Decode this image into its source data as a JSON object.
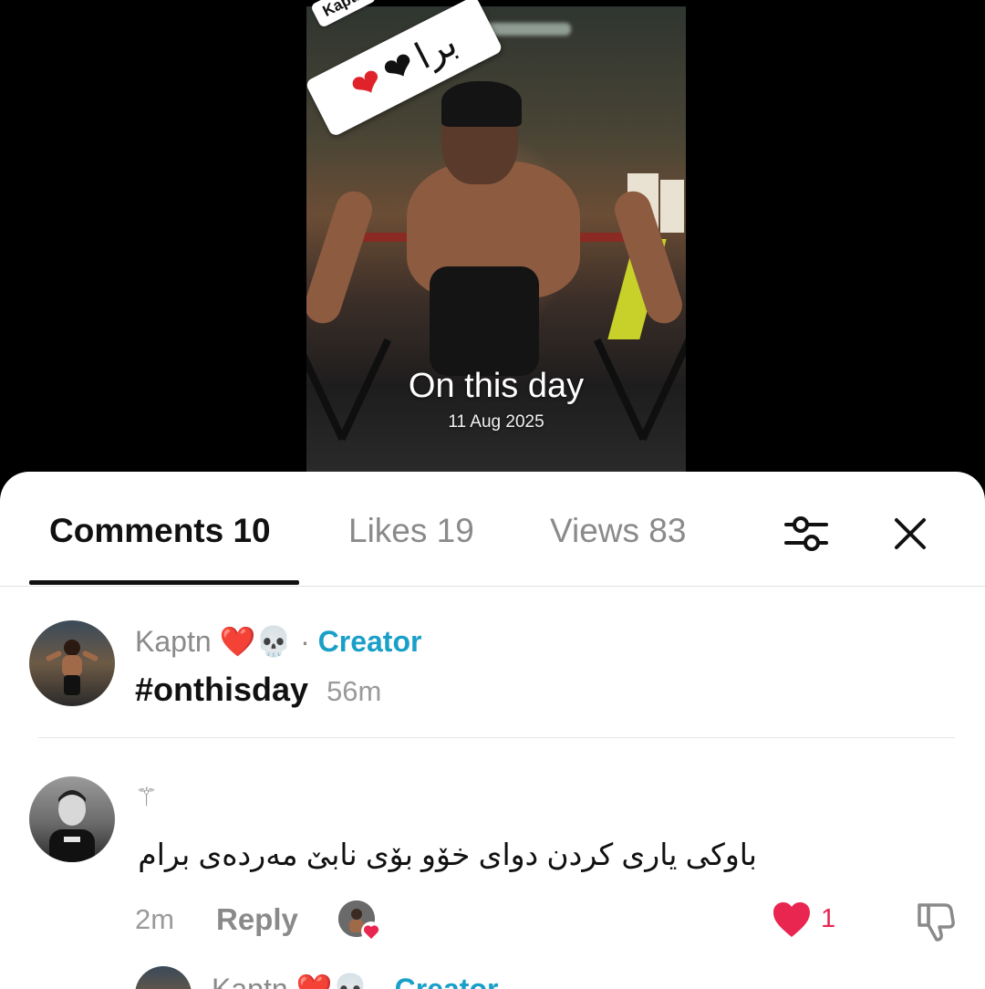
{
  "video": {
    "sticker_username": "Kaptn",
    "sticker_text": "برا",
    "sticker_heart_red": "❤",
    "sticker_heart_black": "❤",
    "overlay_title": "On this day",
    "overlay_date": "11 Aug 2025"
  },
  "sheet": {
    "tabs": [
      {
        "label": "Comments 10",
        "active": true
      },
      {
        "label": "Likes 19",
        "active": false
      },
      {
        "label": "Views 83",
        "active": false
      }
    ],
    "filter_icon": "sliders-icon",
    "close_icon": "close-icon"
  },
  "comments": [
    {
      "username": "Kaptn",
      "emoji_heart": "❤️",
      "emoji_skull": "💀",
      "separator": "·",
      "badge": "Creator",
      "text": "#onthisday",
      "time": "56m"
    },
    {
      "username_glyph": "⚚",
      "text": "باوکی یاری کردن دوای خۆو بۆی نابێ مەردەی برام",
      "time": "2m",
      "reply_label": "Reply",
      "like_count": "1"
    },
    {
      "username": "Kaptn",
      "emoji_heart": "❤️",
      "emoji_skull": "💀",
      "separator": "·",
      "badge": "Creator"
    }
  ],
  "colors": {
    "accent_creator": "#1aa0c8",
    "like_red": "#e8264f"
  }
}
